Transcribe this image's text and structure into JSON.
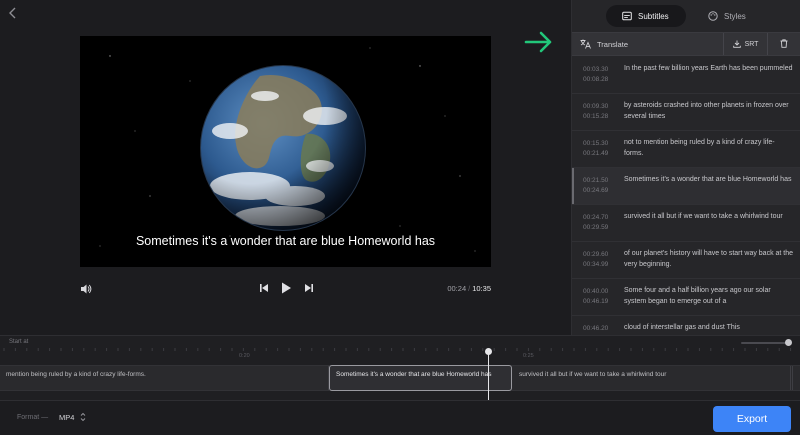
{
  "player": {
    "caption": "Sometimes it's a wonder that are blue Homeworld has",
    "current_time": "00:24",
    "time_separator": "/",
    "duration": "10:35"
  },
  "panel": {
    "tab_subtitles": "Subtitles",
    "tab_styles": "Styles",
    "translate_label": "Translate",
    "srt_label": "SRT",
    "subtitles": [
      {
        "start": "00:03.30",
        "end": "00:08.28",
        "text": "In the past few billion years Earth has been pummeled"
      },
      {
        "start": "00:09.30",
        "end": "00:15.28",
        "text": "by asteroids crashed into other planets in frozen over several times"
      },
      {
        "start": "00:15.30",
        "end": "00:21.49",
        "text": "not to mention being ruled by a kind of crazy life-forms."
      },
      {
        "start": "00:21.50",
        "end": "00:24.69",
        "text": "Sometimes it's a wonder that are blue Homeworld has"
      },
      {
        "start": "00:24.70",
        "end": "00:29.59",
        "text": "survived it all but if we want to take a whirlwind tour"
      },
      {
        "start": "00:29.60",
        "end": "00:34.99",
        "text": "of our planet's history will have to start way back at the very beginning."
      },
      {
        "start": "00:40.00",
        "end": "00:46.19",
        "text": "Some four and a half billion years ago our solar system began to emerge out of a"
      },
      {
        "start": "00:46.20",
        "end": "",
        "text": "cloud of interstellar gas and dust This"
      }
    ]
  },
  "timeline": {
    "start_label": "Start at",
    "ticks": [
      "0:20",
      "0:25"
    ],
    "clips": [
      "mention being ruled by a kind of crazy life-forms.",
      "Sometimes it's a wonder that are blue Homeworld has",
      "survived it all but if we want to take a whirlwind tour"
    ]
  },
  "footer": {
    "format_label": "Format —",
    "format_value": "MP4",
    "export_label": "Export"
  },
  "colors": {
    "accent": "#3d84f7",
    "arrow": "#22c77a"
  }
}
